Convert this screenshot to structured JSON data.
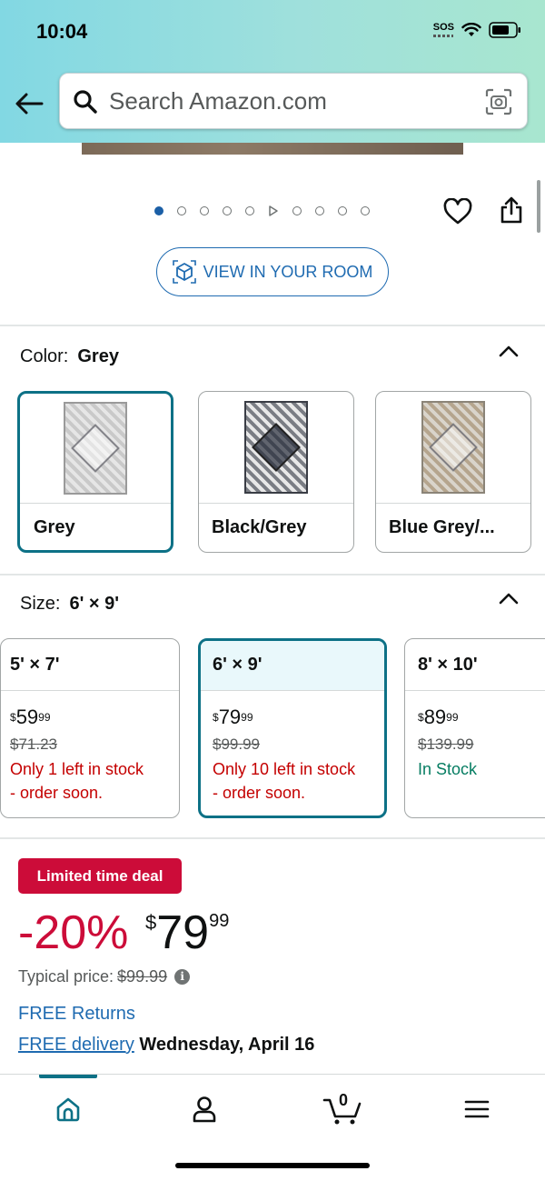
{
  "status_bar": {
    "time": "10:04",
    "sos": "SOS"
  },
  "search": {
    "placeholder": "Search Amazon.com"
  },
  "carousel": {
    "total_items": 10,
    "active_index": 0,
    "video_index": 5
  },
  "view_in_room_label": "VIEW IN YOUR ROOM",
  "color_section": {
    "label": "Color:",
    "selected": "Grey",
    "options": [
      {
        "name": "Grey",
        "selected": true
      },
      {
        "name": "Black/Grey",
        "selected": false
      },
      {
        "name": "Blue Grey/...",
        "selected": false
      }
    ]
  },
  "size_section": {
    "label": "Size:",
    "selected": "6' × 9'",
    "options": [
      {
        "size": "5' × 7'",
        "price_symbol": "$",
        "price_whole": "59",
        "price_fraction": "99",
        "list_price": "$71.23",
        "stock_line1": "Only 1 left in stock",
        "stock_line2": "- order soon.",
        "selected": false
      },
      {
        "size": "6' × 9'",
        "price_symbol": "$",
        "price_whole": "79",
        "price_fraction": "99",
        "list_price": "$99.99",
        "stock_line1": "Only 10 left in stock",
        "stock_line2": "- order soon.",
        "selected": true
      },
      {
        "size": "8' × 10'",
        "price_symbol": "$",
        "price_whole": "89",
        "price_fraction": "99",
        "list_price": "$139.99",
        "stock_line1": "In Stock",
        "stock_line2": "",
        "selected": false
      }
    ]
  },
  "deal": {
    "badge": "Limited time deal",
    "discount": "-20%",
    "price_symbol": "$",
    "price_whole": "79",
    "price_fraction": "99",
    "typical_label": "Typical price:",
    "typical_price": "$99.99"
  },
  "shipping": {
    "free_returns": "FREE Returns",
    "free_delivery": "FREE delivery",
    "delivery_date": "Wednesday, April 16"
  },
  "bottom_nav": {
    "cart_count": "0",
    "items": [
      "home-icon",
      "account-icon",
      "cart-icon",
      "menu-icon"
    ],
    "active": "home-icon"
  },
  "colors": {
    "accent_teal": "#0d7186",
    "link_blue": "#1f6bb1",
    "deal_red": "#cc0c39",
    "in_stock_green": "#067d62"
  }
}
